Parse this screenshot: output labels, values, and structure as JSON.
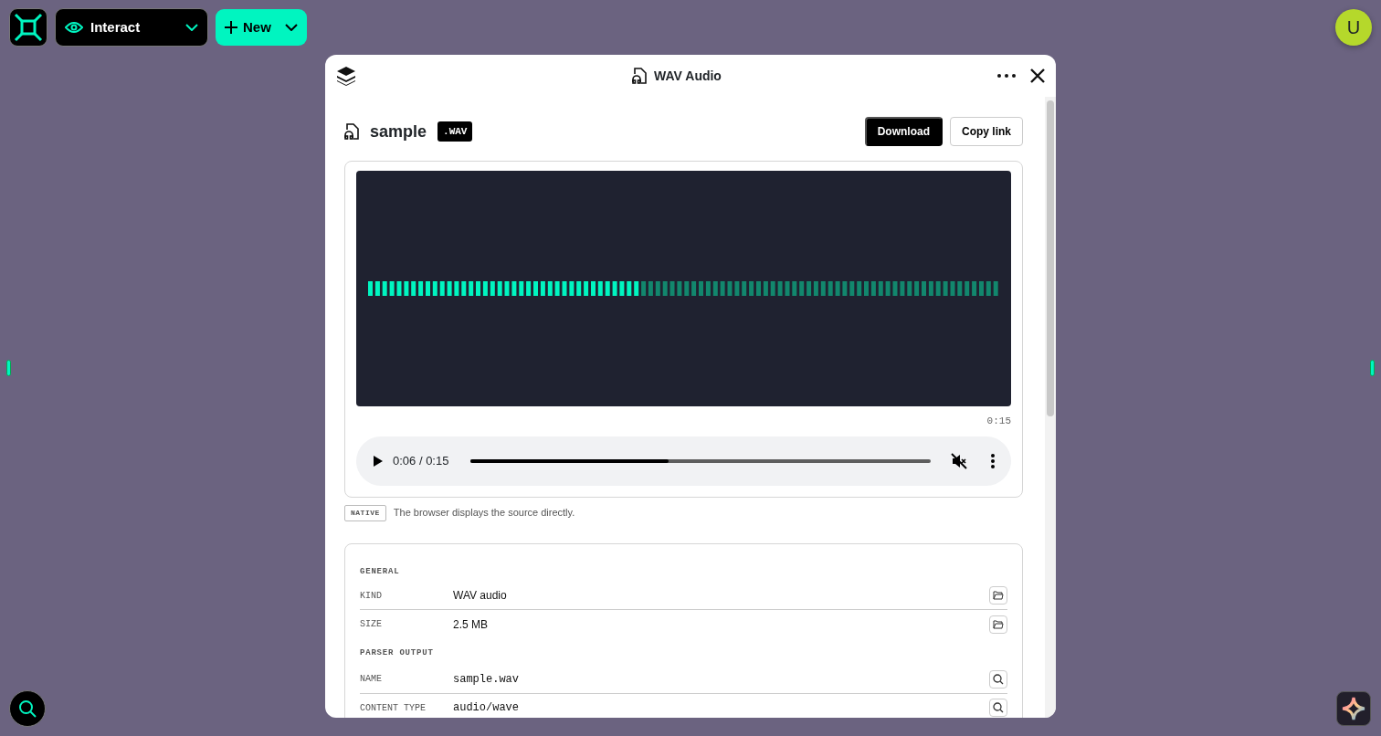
{
  "toolbar": {
    "mode": "Interact",
    "new_button": "New"
  },
  "user": {
    "initial": "U"
  },
  "dialog": {
    "title": "WAV Audio",
    "file": {
      "name": "sample",
      "extension": ".WAV",
      "buttons": [
        "Download",
        "Copy link"
      ]
    },
    "player": {
      "duration": "0:15",
      "time": "0:06 / 0:15",
      "level": 0.43,
      "muted": true
    },
    "renderer": {
      "badge": "NATIVE",
      "note": "The browser displays the source directly."
    },
    "sections": [
      {
        "title": "GENERAL",
        "rows": [
          {
            "label": "KIND",
            "value": "WAV audio",
            "kind": "folder",
            "mono": false
          },
          {
            "label": "SIZE",
            "value": "2.5 MB",
            "kind": "folder",
            "mono": false
          }
        ]
      },
      {
        "title": "PARSER OUTPUT",
        "rows": [
          {
            "label": "NAME",
            "value": "sample.wav",
            "kind": "search",
            "mono": true
          },
          {
            "label": "CONTENT TYPE",
            "value": "audio/wave",
            "kind": "search",
            "mono": true
          }
        ]
      }
    ]
  }
}
